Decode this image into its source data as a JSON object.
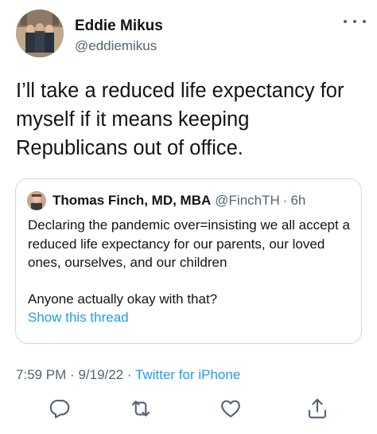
{
  "author": {
    "display_name": "Eddie Mikus",
    "handle": "@eddiemikus"
  },
  "tweet": {
    "text": "I’ll take a reduced life expectancy for myself if it means keeping Republicans out of office."
  },
  "quoted_tweet": {
    "display_name": "Thomas Finch, MD, MBA",
    "handle": "@FinchTH",
    "separator": "·",
    "time": "6h",
    "line1": "Declaring the pandemic over=insisting we all accept a reduced life expectancy for our parents, our loved ones, ourselves, and our children",
    "line2": "Anyone actually okay with that?",
    "show_thread": "Show this thread"
  },
  "meta": {
    "time": "7:59 PM",
    "sep1": "·",
    "date": "9/19/22",
    "sep2": "·",
    "source": "Twitter for iPhone"
  },
  "icons": {
    "more": "more-icon",
    "reply": "reply-icon",
    "retweet": "retweet-icon",
    "like": "like-icon",
    "share": "share-icon"
  },
  "colors": {
    "text": "#0f1419",
    "secondary": "#536471",
    "link": "#1d9bf0",
    "border": "#cfd9de"
  }
}
